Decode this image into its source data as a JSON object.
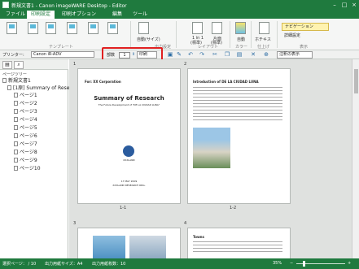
{
  "window": {
    "title": "新規文書1 - Canon imageWARE Desktop - Editor"
  },
  "menu": {
    "tabs": [
      "ファイル",
      "印刷設定",
      "印刷オプション",
      "編集",
      "ツール"
    ],
    "active_index": 1
  },
  "ribbon": {
    "template_group": "テンプレート",
    "auto_size": "自動(サイズ)",
    "print_settings": "出力設定",
    "layout_1in1": "1 in 1",
    "layout_1in1_sub": "(標準)",
    "layout_one_side": "片面",
    "layout_one_side_sub": "(標準)",
    "layout_group": "レイアウト",
    "color_label": "自動",
    "color_group": "カラー",
    "staple_label": "ホチキス",
    "finish_group": "仕上げ",
    "navigation": "ナビゲーション",
    "detail": "詳細設定",
    "display_group": "表示"
  },
  "toolbar": {
    "printer_label": "プリンター:",
    "printer_value": "Canon iR-ADV",
    "copies_label": "部数",
    "copies_value": "1",
    "print_button": "印刷",
    "show_toggle": "注釈の表示"
  },
  "sidepanel": {
    "header": "ページツリー",
    "root": "新規文書1",
    "doc": "[1原] Summary of Resea",
    "pages": [
      "ページ1",
      "ページ2",
      "ページ3",
      "ページ4",
      "ページ5",
      "ページ6",
      "ページ7",
      "ページ8",
      "ページ9",
      "ページ10"
    ]
  },
  "preview": {
    "page1": {
      "number": "1",
      "caption": "1-1",
      "header": "For: XX Corporation",
      "title": "Summary of Research",
      "subtitle": "The Future Development of \"DE LA CIUDAD LUNA\"",
      "date": "17 MAY 2009",
      "org": "XXXLAND RESEARCH ORG.",
      "logo_text": "XXXLAND"
    },
    "page2": {
      "number": "2",
      "caption": "1-2",
      "title": "Introduction of DE LA CIUDAD LUNA"
    },
    "page3": {
      "number": "3"
    },
    "page4": {
      "number": "4",
      "title": "Towns"
    }
  },
  "status": {
    "selection": "選択ページ： / 10",
    "size": "出力用紙サイズ：A4",
    "sheets": "出力用紙枚数：10",
    "zoom": "35%"
  }
}
